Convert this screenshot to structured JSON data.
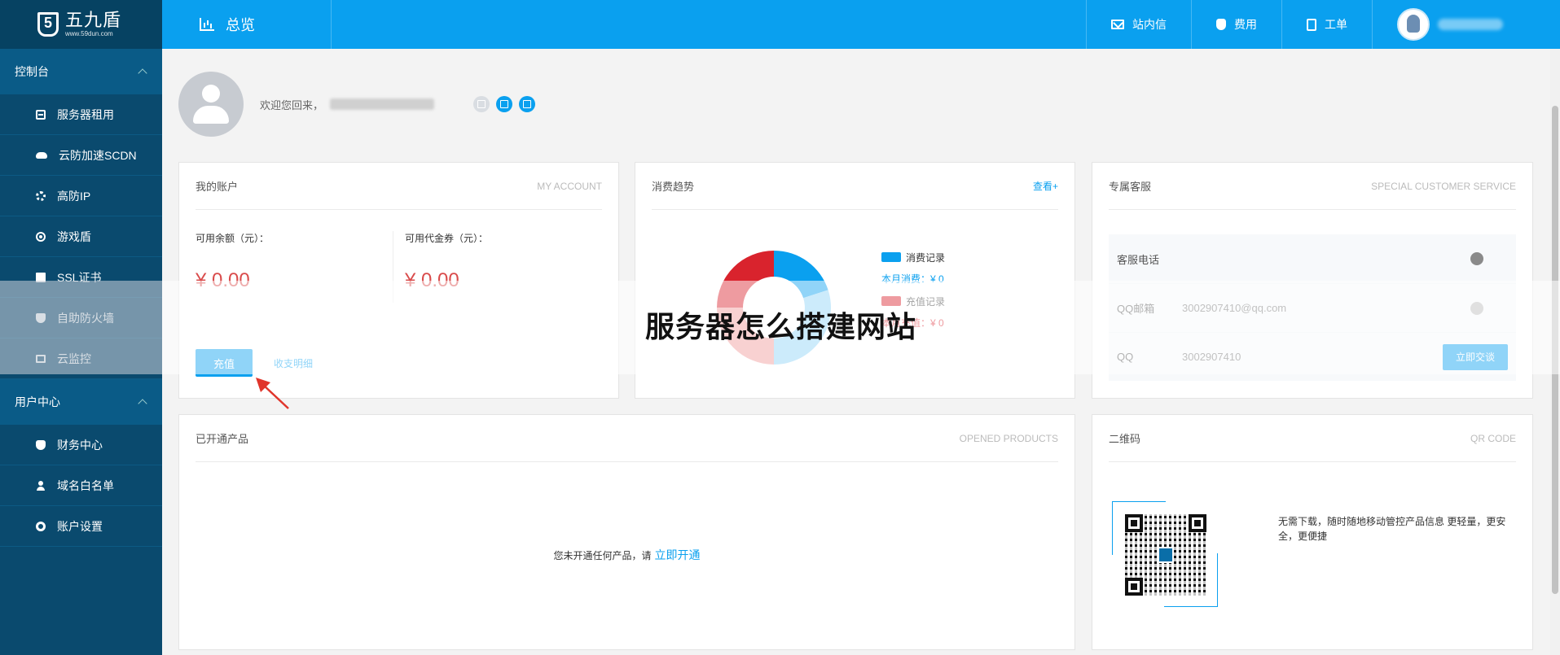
{
  "brand": {
    "name": "五九盾",
    "url": "www.59dun.com"
  },
  "header": {
    "title": "总览",
    "nav": [
      {
        "label": "站内信",
        "icon": "mail-icon"
      },
      {
        "label": "费用",
        "icon": "money-bag-icon"
      },
      {
        "label": "工单",
        "icon": "ticket-icon"
      }
    ]
  },
  "sidebar": {
    "groups": [
      {
        "label": "控制台",
        "items": [
          {
            "label": "服务器租用",
            "icon": "server-icon"
          },
          {
            "label": "云防加速SCDN",
            "icon": "cloud-icon"
          },
          {
            "label": "高防IP",
            "icon": "gear-icon"
          },
          {
            "label": "游戏盾",
            "icon": "target-icon"
          },
          {
            "label": "SSL证书",
            "icon": "certificate-icon"
          },
          {
            "label": "自助防火墙",
            "icon": "shield-icon"
          },
          {
            "label": "云监控",
            "icon": "monitor-icon"
          }
        ]
      },
      {
        "label": "用户中心",
        "items": [
          {
            "label": "财务中心",
            "icon": "money-bag-icon"
          },
          {
            "label": "域名白名单",
            "icon": "user-icon"
          },
          {
            "label": "账户设置",
            "icon": "settings-icon"
          }
        ]
      }
    ]
  },
  "welcome": {
    "text": "欢迎您回来，"
  },
  "account": {
    "title": "我的账户",
    "subtitle": "MY ACCOUNT",
    "balance_label": "可用余额（元）：",
    "balance_value": "¥ 0.00",
    "voucher_label": "可用代金券（元）：",
    "voucher_value": "¥ 0.00",
    "recharge_button": "充值",
    "detail_link": "收支明细"
  },
  "trend": {
    "title": "消费趋势",
    "more_link": "查看+",
    "legend": [
      {
        "label": "消费记录",
        "color": "#0aa0ef"
      },
      {
        "label": "充值记录",
        "color": "#d9232d"
      }
    ],
    "stats": {
      "month_spend": "本月消费：¥ 0",
      "month_recharge": "本月充值：¥ 0"
    },
    "donut_colors": [
      "#0aa0ef",
      "#8fd3f7",
      "#f09a9a",
      "#d9232d"
    ]
  },
  "service": {
    "title": "专属客服",
    "subtitle": "SPECIAL CUSTOMER SERVICE",
    "phone_label": "客服电话",
    "email_label": "QQ邮箱",
    "email_value": "3002907410@qq.com",
    "qq_label": "QQ",
    "qq_value": "3002907410",
    "chat_button": "立即交谈"
  },
  "products": {
    "title": "已开通产品",
    "subtitle": "OPENED PRODUCTS",
    "empty_text": "您未开通任何产品，请",
    "empty_link": "立即开通"
  },
  "qr": {
    "title": "二维码",
    "subtitle": "QR CODE",
    "description": "无需下载，随时随地移动管控产品信息 更轻量，更安全，更便捷"
  },
  "watermark": "服务器怎么搭建网站"
}
